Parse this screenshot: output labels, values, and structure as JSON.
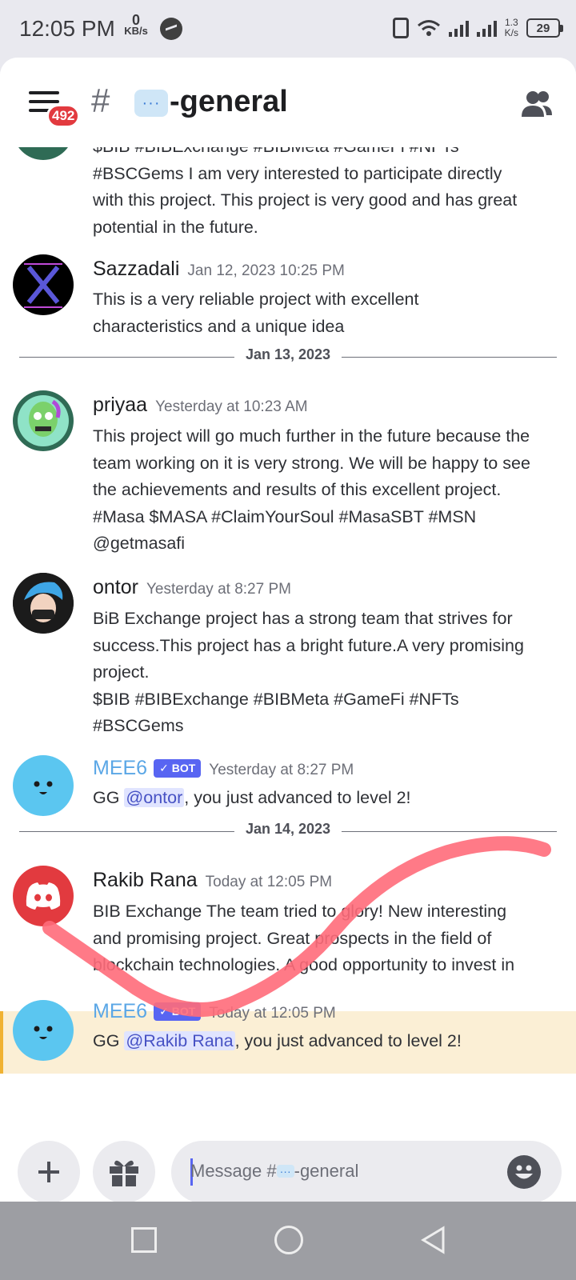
{
  "status_bar": {
    "time": "12:05 PM",
    "net_speed_value": "0",
    "net_speed_unit": "KB/s",
    "right_rate_value": "1.3",
    "right_rate_unit": "K/s",
    "battery": "29"
  },
  "header": {
    "unread_badge": "492",
    "hash": "#",
    "channel_emoji": "···",
    "channel_name": "-general"
  },
  "messages": [
    {
      "body_lines": [
        "$BIB #BIBExchange #BIBMeta #GameFi #NFTs",
        "#BSCGems  I am very interested to participate directly",
        "with this project. This project is very good and has great",
        "potential in the future."
      ]
    },
    {
      "username": "Sazzadali",
      "timestamp": "Jan 12, 2023 10:25 PM",
      "body_lines": [
        "This is a very reliable project with excellent",
        "characteristics and a unique idea"
      ]
    },
    {
      "username": "priyaa",
      "timestamp": "Yesterday at 10:23 AM",
      "body_lines": [
        "This project will go much further in the future because the",
        "team working on it is very strong. We will be happy to see",
        "the achievements and results of this excellent project.",
        "#Masa $MASA #ClaimYourSoul #MasaSBT #MSN",
        "@getmasafi"
      ]
    },
    {
      "username": "ontor",
      "timestamp": "Yesterday at 8:27 PM",
      "body_lines": [
        "BiB Exchange project has a strong team that strives for",
        "success.This project has a bright future.A very promising",
        "project.",
        "$BIB #BIBExchange #BIBMeta #GameFi #NFTs",
        "#BSCGems"
      ]
    },
    {
      "username": "MEE6",
      "bot_label": "✓ BOT",
      "timestamp": "Yesterday at 8:27 PM",
      "pre": "GG ",
      "mention": "@ontor",
      "post": ", you just advanced to level 2!"
    },
    {
      "username": "Rakib Rana",
      "timestamp": "Today at 12:05 PM",
      "body_lines": [
        "BIB Exchange  The team tried to glory! New interesting",
        "and promising project. Great prospects in the field of",
        "blockchain technologies. A good opportunity to invest in"
      ]
    },
    {
      "username": "MEE6",
      "bot_label": "✓ BOT",
      "timestamp": "Today at 12:05 PM",
      "pre": "GG ",
      "mention": "@Rakib Rana",
      "post": ", you just advanced to level 2!"
    }
  ],
  "dividers": [
    "Jan 13, 2023",
    "Jan 14, 2023"
  ],
  "input": {
    "placeholder_prefix": "Message #",
    "placeholder_emoji": "···",
    "placeholder_channel": "-general"
  },
  "colors": {
    "accent": "#5865f2",
    "mention_bg": "#e0e4ff",
    "highlight_bg": "#fbefd5",
    "scribble": "#ff6b7a"
  }
}
